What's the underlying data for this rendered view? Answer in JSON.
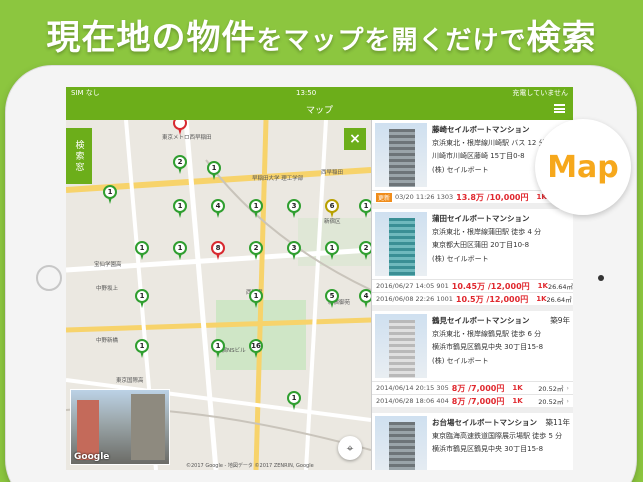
{
  "headline": {
    "part1": "現在地の物件",
    "part2": "をマップを開くだけで",
    "part3": "検索"
  },
  "status": {
    "carrier": "SIM なし",
    "time": "13:50",
    "battery_text": "充電していません"
  },
  "nav": {
    "title": "マップ"
  },
  "map": {
    "search_tab": "検索窓",
    "close_label": "×",
    "google_label": "Google",
    "copyright": "©2017 Google - 地図データ ©2017 ZENRIN, Google",
    "labels": [
      "東京メトロ西早稲田",
      "早稲田大学 理工学部",
      "西早稲田",
      "新宿区",
      "新宿御苑",
      "宝仙学園高",
      "中野坂上",
      "新宿NSビル",
      "東京国際高",
      "中野新橋",
      "西新宿"
    ],
    "pins": [
      {
        "n": "",
        "color": "red"
      },
      {
        "n": "2",
        "color": "green"
      },
      {
        "n": "1",
        "color": "green"
      },
      {
        "n": "1",
        "color": "green"
      },
      {
        "n": "1",
        "color": "green"
      },
      {
        "n": "4",
        "color": "green"
      },
      {
        "n": "1",
        "color": "green"
      },
      {
        "n": "3",
        "color": "green"
      },
      {
        "n": "6",
        "color": "yellow"
      },
      {
        "n": "1",
        "color": "green"
      },
      {
        "n": "1",
        "color": "green"
      },
      {
        "n": "1",
        "color": "green"
      },
      {
        "n": "8",
        "color": "red"
      },
      {
        "n": "2",
        "color": "green"
      },
      {
        "n": "3",
        "color": "green"
      },
      {
        "n": "1",
        "color": "green"
      },
      {
        "n": "2",
        "color": "green"
      },
      {
        "n": "1",
        "color": "green"
      },
      {
        "n": "5",
        "color": "green"
      },
      {
        "n": "1",
        "color": "green"
      },
      {
        "n": "16",
        "color": "green"
      },
      {
        "n": "1",
        "color": "green"
      },
      {
        "n": "1",
        "color": "green"
      },
      {
        "n": "1",
        "color": "green"
      },
      {
        "n": "4",
        "color": "green"
      }
    ]
  },
  "listings": [
    {
      "name": "藤崎セイルボートマンション",
      "age": "築3",
      "line1": "京浜東北・根岸線川崎駅 バス 12 分",
      "line2": "川崎市川崎区藤崎 15丁目0-8",
      "owner": "(株) セイルボート",
      "tower": "",
      "rows": [
        {
          "badge": "更新",
          "date": "03/20 11:26",
          "room": "1303",
          "price": "13.8万 /10,000円",
          "layout": "1K",
          "area": ""
        }
      ]
    },
    {
      "name": "蒲田セイルボートマンション",
      "age": "",
      "line1": "京浜東北・根岸線蒲田駅 徒歩 4 分",
      "line2": "東京都大田区蒲田 20丁目10-8",
      "owner": "(株) セイルボート",
      "tower": "teal",
      "rows": [
        {
          "badge": "",
          "date": "2016/06/27 14:05",
          "room": "901",
          "price": "10.45万 /12,000円",
          "layout": "1K",
          "area": "26.64㎡"
        },
        {
          "badge": "",
          "date": "2016/06/08 22:26",
          "room": "1001",
          "price": "10.5万 /12,000円",
          "layout": "1K",
          "area": "26.64㎡"
        }
      ]
    },
    {
      "name": "鶴見セイルボートマンション",
      "age": "築9年",
      "line1": "京浜東北・根岸線鶴見駅 徒歩 6 分",
      "line2": "横浜市鶴見区鶴見中央 30丁目15-8",
      "owner": "(株) セイルボート",
      "tower": "light",
      "rows": [
        {
          "badge": "",
          "date": "2014/06/14 20:15",
          "room": "305",
          "price": "8万 /7,000円",
          "layout": "1K",
          "area": "20.52㎡"
        },
        {
          "badge": "",
          "date": "2014/06/28 18:06",
          "room": "404",
          "price": "8万 /7,000円",
          "layout": "1K",
          "area": "20.52㎡"
        }
      ]
    },
    {
      "name": "お台場セイルボートマンション",
      "age": "築11年",
      "line1": "東京臨海高速鉄道国際展示場駅 徒歩 5 分",
      "line2": "横浜市鶴見区鶴見中央 30丁目15-8",
      "owner": "",
      "tower": "",
      "rows": []
    }
  ],
  "map_badge": "Map",
  "colors": {
    "brand": "#6cae1a",
    "background": "#8cc63f",
    "price": "#e0282e",
    "badge": "#f6a81c"
  }
}
